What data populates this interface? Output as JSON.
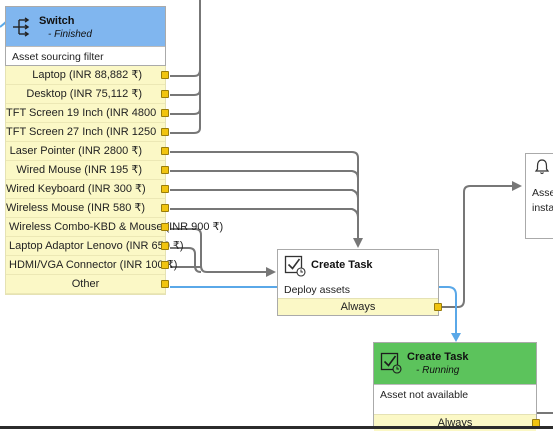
{
  "switch_node": {
    "title": "Switch",
    "status": "- Finished",
    "description": "Asset sourcing filter",
    "header_color": "#80b6ef",
    "icon": "switch-icon",
    "outputs": [
      "Laptop (INR 88,882 ₹)",
      "Desktop (INR 75,112 ₹)",
      "TFT Screen 19 Inch (INR 4800",
      "TFT Screen 27 Inch (INR 1250",
      "Laser Pointer (INR 2800 ₹)",
      "Wired Mouse (INR 195 ₹)",
      "Wired Keyboard (INR 300 ₹)",
      "Wireless Mouse (INR 580 ₹)",
      "Wireless Combo-KBD & Mouse (INR 900 ₹)",
      "Laptop Adaptor Lenovo (INR 650 ₹)",
      "HDMI/VGA Connector (INR 100 ₹)",
      "Other"
    ]
  },
  "task_deploy": {
    "title": "Create Task",
    "description": "Deploy assets",
    "footer": "Always",
    "icon": "task-checkbox-icon"
  },
  "task_unavailable": {
    "title": "Create Task",
    "status": "- Running",
    "description": "Asset not available",
    "footer": "Always",
    "header_color": "#5cc35c",
    "icon": "task-checkbox-icon"
  },
  "notify_node": {
    "line1": "Asse",
    "line2": "insta",
    "icon": "bell-icon"
  },
  "colors": {
    "wire": "#777777",
    "wire_selected": "#5aa8e8",
    "port": "#f1c40f",
    "output_bg": "#fbf8c6"
  }
}
